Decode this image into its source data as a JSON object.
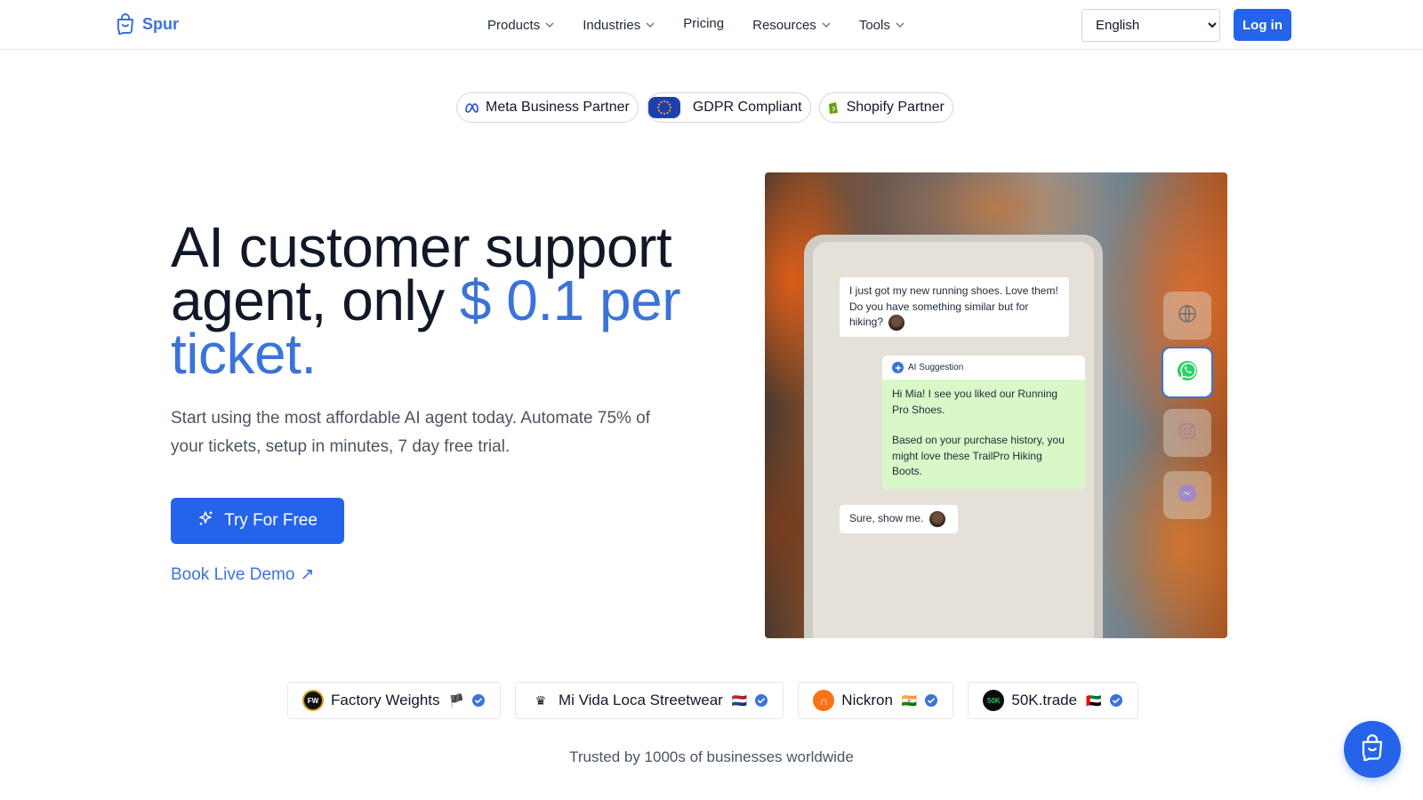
{
  "brand": {
    "name": "Spur",
    "logo_icon": "shopping-bag-chat-icon",
    "accent": "#3b73d9",
    "primary": "#2563eb"
  },
  "nav": {
    "items": [
      {
        "label": "Products",
        "dropdown": true
      },
      {
        "label": "Industries",
        "dropdown": true
      },
      {
        "label": "Pricing",
        "dropdown": false
      },
      {
        "label": "Resources",
        "dropdown": true
      },
      {
        "label": "Tools",
        "dropdown": true
      }
    ],
    "language": {
      "selected": "English",
      "options": [
        "English"
      ]
    },
    "login_label": "Log in"
  },
  "badges": [
    {
      "label": "Meta Business Partner",
      "icon": "meta-icon"
    },
    {
      "label": "GDPR Compliant",
      "icon": "eu-flag-icon"
    },
    {
      "label": "Shopify Partner",
      "icon": "shopify-icon"
    }
  ],
  "hero": {
    "title_plain": "AI customer support agent, only ",
    "title_accent": "$ 0.1 per ticket.",
    "subtitle": "Start using the most affordable AI agent today. Automate 75% of your tickets, setup in minutes, 7 day free trial.",
    "cta_label": "Try For Free",
    "demo_label": "Book Live Demo",
    "demo_arrow": "↗"
  },
  "chat_demo": {
    "customer_msg": "I just got my new running shoes. Love them! Do you have something similar but for hiking?",
    "ai_label": "AI Suggestion",
    "ai_reply_1": "Hi Mia! I see you liked our Running Pro Shoes.",
    "ai_reply_2": "Based on your purchase history, you might love these TrailPro Hiking Boots.",
    "customer_reply": "Sure, show me.",
    "channels": [
      "globe-icon",
      "whatsapp-icon",
      "instagram-icon",
      "messenger-icon"
    ]
  },
  "clients": [
    {
      "name": "Factory Weights",
      "flag": "🏴",
      "logo_color": "#111111"
    },
    {
      "name": "Mi Vida Loca Streetwear",
      "flag": "🇳🇱",
      "logo_color": "#ffffff"
    },
    {
      "name": "Nickron",
      "flag": "🇮🇳",
      "logo_color": "#f97316"
    },
    {
      "name": "50K.trade",
      "flag": "🇦🇪",
      "logo_color": "#0b0b0b"
    }
  ],
  "trusted_text": "Trusted by 1000s of businesses worldwide"
}
